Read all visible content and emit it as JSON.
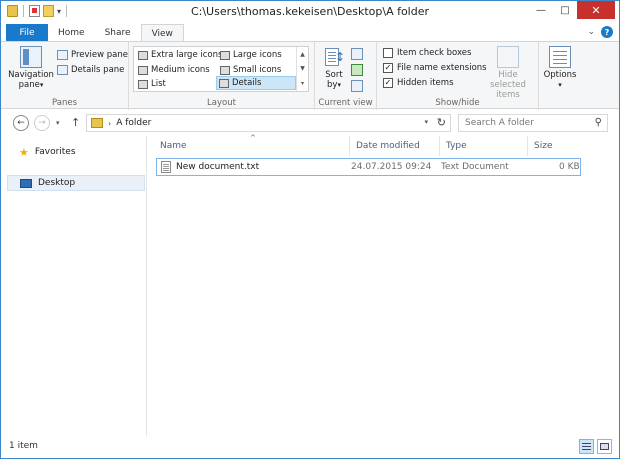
{
  "window": {
    "title": "C:\\Users\\thomas.kekeisen\\Desktop\\A folder",
    "controls": {
      "minimize": "—",
      "maximize": "□",
      "close": "✕"
    }
  },
  "quick_access": {
    "dropdown": "▾"
  },
  "tabs": [
    {
      "label": "File"
    },
    {
      "label": "Home"
    },
    {
      "label": "Share"
    },
    {
      "label": "View"
    }
  ],
  "tab_right": {
    "expand": "⌄",
    "help": "?"
  },
  "ribbon": {
    "panes": {
      "group_label": "Panes",
      "navigation_pane": "Navigation",
      "navigation_pane_2": "pane",
      "preview_pane": "Preview pane",
      "details_pane": "Details pane"
    },
    "layout": {
      "group_label": "Layout",
      "items": [
        "Extra large icons",
        "Large icons",
        "Medium icons",
        "Small icons",
        "List",
        "Details"
      ],
      "selected": "Details"
    },
    "current_view": {
      "group_label": "Current view",
      "sort_by": "Sort",
      "sort_by_2": "by"
    },
    "show_hide": {
      "group_label": "Show/hide",
      "item_check_boxes": "Item check boxes",
      "file_name_extensions": "File name extensions",
      "hidden_items": "Hidden items",
      "hide_selected_items": "Hide selected",
      "hide_selected_items_2": "items",
      "checks": {
        "item_check_boxes": "",
        "file_name_extensions": "✓",
        "hidden_items": "✓"
      }
    },
    "options": {
      "label": "Options"
    }
  },
  "address": {
    "back": "←",
    "forward": "→",
    "recent": "▾",
    "up": "↑",
    "chevron": "›",
    "path": "A folder",
    "dropdown": "▾",
    "refresh": "↻",
    "search_placeholder": "Search A folder",
    "search_glyph": "⚲"
  },
  "navpane": {
    "favorites": "Favorites",
    "desktop": "Desktop"
  },
  "columns": {
    "name": "Name",
    "date_modified": "Date modified",
    "type": "Type",
    "size": "Size",
    "sort_indicator": "^"
  },
  "files": [
    {
      "name": "New document.txt",
      "date_modified": "24.07.2015 09:24",
      "type": "Text Document",
      "size": "0 KB"
    }
  ],
  "status": {
    "count": "1 item"
  }
}
